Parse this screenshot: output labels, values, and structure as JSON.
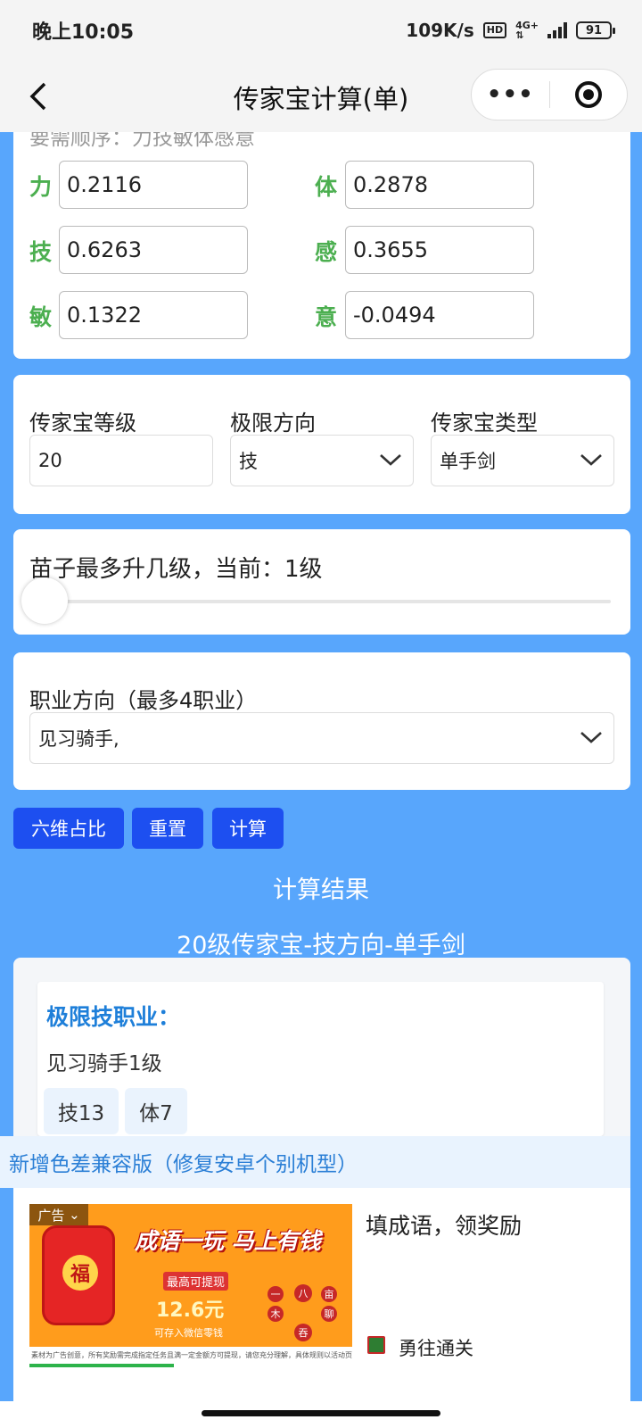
{
  "status_bar": {
    "time": "晚上10:05",
    "speed": "109K/s",
    "hd": "HD",
    "net_top": "4G+",
    "net_bottom": "⇅",
    "battery": "91"
  },
  "navbar": {
    "title": "传家宝计算(单)",
    "more_label": "•••"
  },
  "attrs_card": {
    "cut_text": "要需顺序：力技敏体感意",
    "items": [
      {
        "label": "力",
        "value": "0.2116"
      },
      {
        "label": "体",
        "value": "0.2878"
      },
      {
        "label": "技",
        "value": "0.6263"
      },
      {
        "label": "感",
        "value": "0.3655"
      },
      {
        "label": "敏",
        "value": "0.1322"
      },
      {
        "label": "意",
        "value": "-0.0494"
      }
    ]
  },
  "config_card": {
    "level_label": "传家宝等级",
    "level_value": "20",
    "direction_label": "极限方向",
    "direction_value": "技",
    "type_label": "传家宝类型",
    "type_value": "单手剑"
  },
  "slider_card": {
    "label": "苗子最多升几级，当前：1级",
    "value": 1
  },
  "job_card": {
    "label": "职业方向（最多4职业）",
    "value": "见习骑手,"
  },
  "buttons": {
    "ratio": "六维占比",
    "reset": "重置",
    "calc": "计算"
  },
  "result": {
    "heading": "计算结果",
    "subheading": "20级传家宝-技方向-单手剑",
    "job_title": "极限技职业：",
    "job_line": "见习骑手1级",
    "chips": [
      "技13",
      "体7"
    ]
  },
  "notice": "新增色差兼容版（修复安卓个别机型）",
  "ad": {
    "tag": "广告",
    "headline": "成语一玩 马上有钱",
    "fu": "福",
    "highest": "最高可提现",
    "amount": "12.6元",
    "deposit": "可存入微信零钱",
    "disclaimer": "素材为广告创意，所有奖励需完成指定任务且满一定金额方可提现，请您充分理解，具体规则以活动页面为准",
    "title": "填成语，领奖励",
    "app_name": "勇往通关",
    "grid_chars": [
      "一",
      "八",
      "亩",
      "木",
      "聊",
      "吞"
    ]
  }
}
